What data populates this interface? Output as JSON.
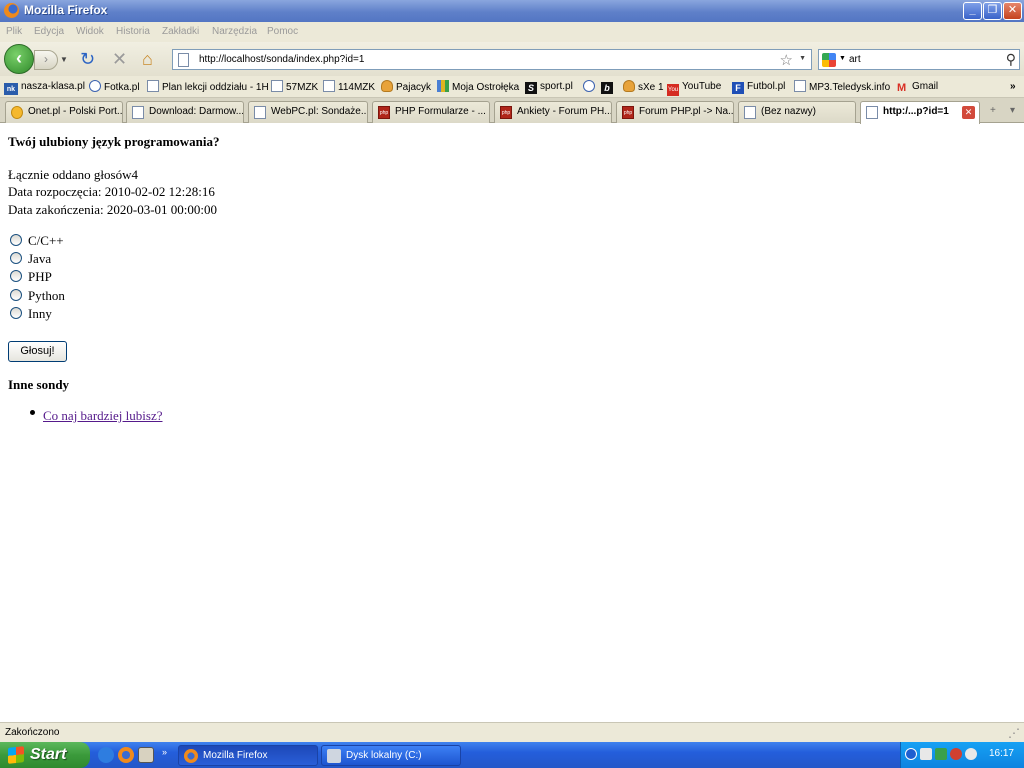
{
  "window": {
    "title": "Mozilla Firefox"
  },
  "menu": [
    "Plik",
    "Edycja",
    "Widok",
    "Historia",
    "Zakładki",
    "Narzędzia",
    "Pomoc"
  ],
  "nav": {
    "url": "http://localhost/sonda/index.php?id=1",
    "search_value": "art"
  },
  "bookmarks": [
    "nasza-klasa.pl",
    "Fotka.pl",
    "Plan lekcji oddziału - 1H",
    "57MZK",
    "114MZK",
    "Pajacyk",
    "Moja Ostrołęka",
    "sport.pl",
    "sXe 1",
    "YouTube",
    "Futbol.pl",
    "MP3.Teledysk.info",
    "Gmail"
  ],
  "tabs": [
    {
      "label": "Onet.pl - Polski Port...",
      "active": false
    },
    {
      "label": "Download: Darmow...",
      "active": false
    },
    {
      "label": "WebPC.pl: Sondaże...",
      "active": false
    },
    {
      "label": "PHP Formularze - ...",
      "active": false
    },
    {
      "label": "Ankiety - Forum PH...",
      "active": false
    },
    {
      "label": "Forum PHP.pl -> Na...",
      "active": false
    },
    {
      "label": "(Bez nazwy)",
      "active": false
    },
    {
      "label": "http:/...p?id=1",
      "active": true
    }
  ],
  "poll": {
    "question": "Twój ulubiony język programowania?",
    "votes_text": "Łącznie oddano głosów4",
    "start_text": "Data rozpoczęcia: 2010-02-02 12:28:16",
    "end_text": "Data zakończenia: 2020-03-01 00:00:00",
    "options": [
      "C/C++",
      "Java",
      "PHP",
      "Python",
      "Inny"
    ],
    "vote_button": "Głosuj!",
    "other_heading": "Inne sondy",
    "other_link": "Co naj bardziej lubisz?"
  },
  "status": {
    "text": "Zakończono"
  },
  "taskbar": {
    "start": "Start",
    "tasks": [
      "Mozilla Firefox",
      "Dysk lokalny (C:)"
    ],
    "clock": "16:17"
  }
}
